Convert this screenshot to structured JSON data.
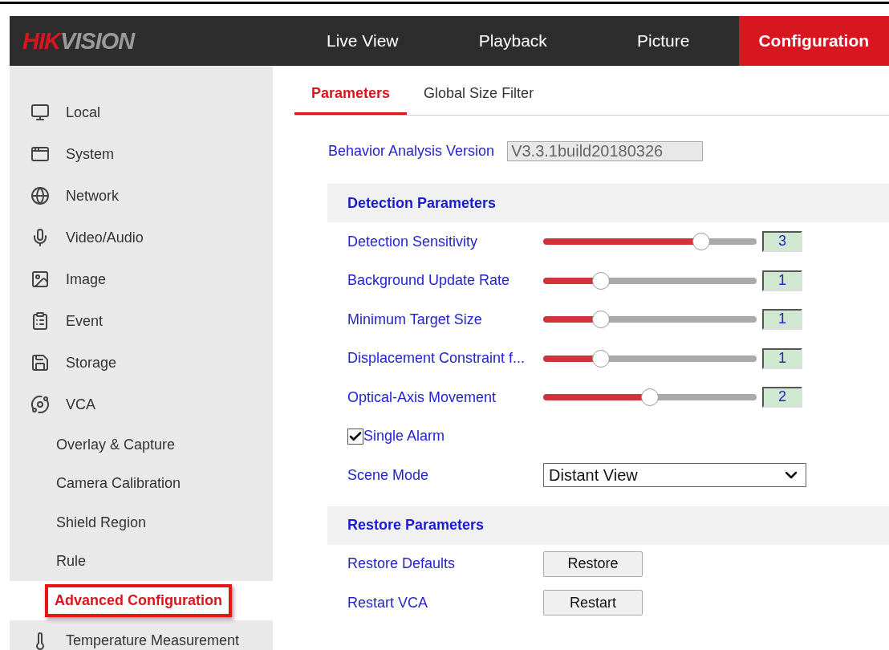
{
  "logo": {
    "accent": "HIK",
    "rest": "VISION"
  },
  "nav": [
    {
      "label": "Live View",
      "selected": false
    },
    {
      "label": "Playback",
      "selected": false
    },
    {
      "label": "Picture",
      "selected": false
    },
    {
      "label": "Configuration",
      "selected": true
    }
  ],
  "sidebar": {
    "items": [
      {
        "label": "Local"
      },
      {
        "label": "System"
      },
      {
        "label": "Network"
      },
      {
        "label": "Video/Audio"
      },
      {
        "label": "Image"
      },
      {
        "label": "Event"
      },
      {
        "label": "Storage"
      },
      {
        "label": "VCA",
        "children": [
          {
            "label": "Overlay & Capture",
            "selected": false
          },
          {
            "label": "Camera Calibration",
            "selected": false
          },
          {
            "label": "Shield Region",
            "selected": false
          },
          {
            "label": "Rule",
            "selected": false
          },
          {
            "label": "Advanced Configuration",
            "selected": true
          }
        ]
      },
      {
        "label": "Temperature Measurement"
      }
    ]
  },
  "tabs": [
    {
      "label": "Parameters",
      "selected": true
    },
    {
      "label": "Global Size Filter",
      "selected": false
    }
  ],
  "version": {
    "label": "Behavior Analysis Version",
    "value": "V3.3.1build20180326"
  },
  "detection": {
    "title": "Detection Parameters",
    "sliders": [
      {
        "label": "Detection Sensitivity",
        "level": 0.74,
        "value": "3"
      },
      {
        "label": "Background Update Rate",
        "level": 0.27,
        "value": "1"
      },
      {
        "label": "Minimum Target Size",
        "level": 0.27,
        "value": "1"
      },
      {
        "label": "Displacement Constraint f...",
        "level": 0.27,
        "value": "1"
      },
      {
        "label": "Optical-Axis Movement",
        "level": 0.5,
        "value": "2"
      }
    ],
    "single_alarm": {
      "label": "Single Alarm",
      "checked": true
    },
    "scene_mode": {
      "label": "Scene Mode",
      "value": "Distant View"
    }
  },
  "restore": {
    "title": "Restore Parameters",
    "actions": [
      {
        "label": "Restore Defaults",
        "button": "Restore"
      },
      {
        "label": "Restart VCA",
        "button": "Restart"
      }
    ]
  }
}
